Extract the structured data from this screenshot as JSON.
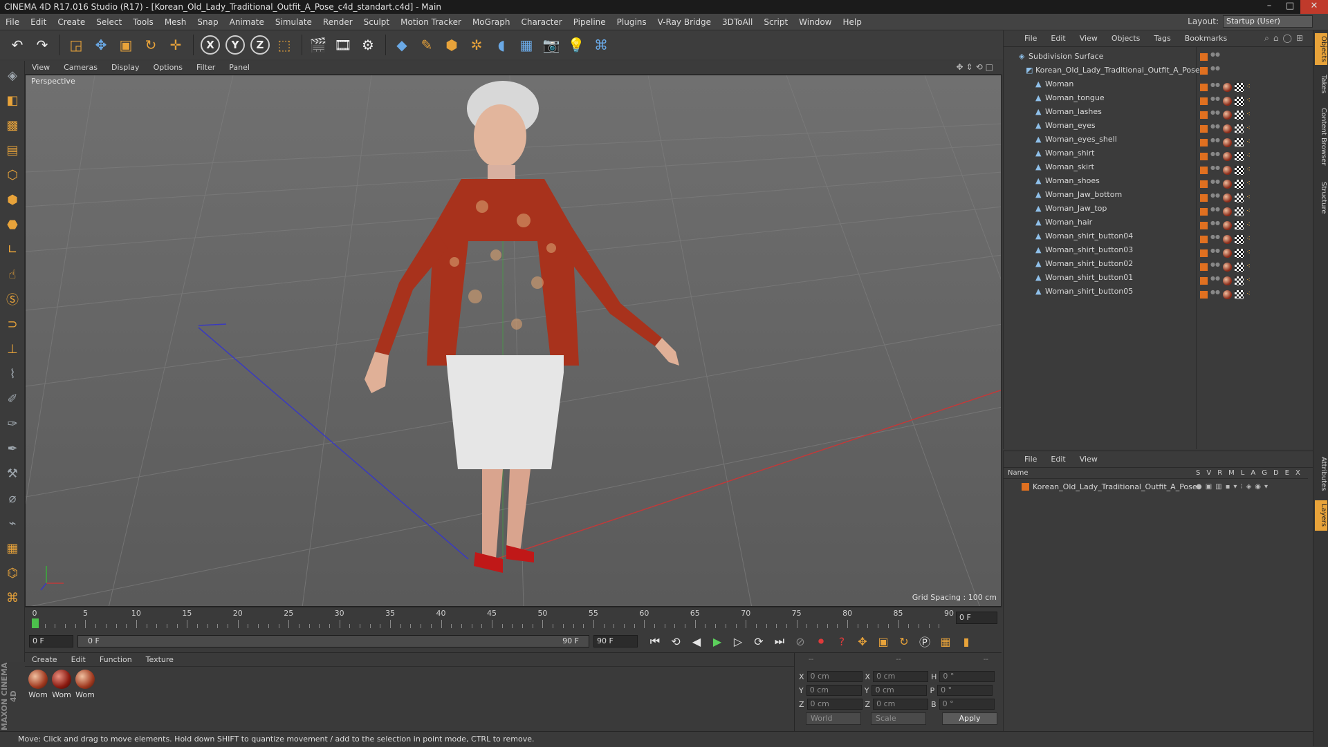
{
  "window": {
    "title": "CINEMA 4D R17.016 Studio (R17) - [Korean_Old_Lady_Traditional_Outfit_A_Pose_c4d_standart.c4d] - Main"
  },
  "menu": [
    "File",
    "Edit",
    "Create",
    "Select",
    "Tools",
    "Mesh",
    "Snap",
    "Animate",
    "Simulate",
    "Render",
    "Sculpt",
    "Motion Tracker",
    "MoGraph",
    "Character",
    "Pipeline",
    "Plugins",
    "V-Ray Bridge",
    "3DToAll",
    "Script",
    "Window",
    "Help"
  ],
  "layout": {
    "label": "Layout:",
    "value": "Startup (User)"
  },
  "toolbar": {
    "x_label": "X",
    "y_label": "Y",
    "z_label": "Z"
  },
  "viewport": {
    "menu": [
      "View",
      "Cameras",
      "Display",
      "Options",
      "Filter",
      "Panel"
    ],
    "label": "Perspective",
    "grid_spacing": "Grid Spacing : 100 cm"
  },
  "timeline": {
    "ticks": [
      "0",
      "5",
      "10",
      "15",
      "20",
      "25",
      "30",
      "35",
      "40",
      "45",
      "50",
      "55",
      "60",
      "65",
      "70",
      "75",
      "80",
      "85",
      "90"
    ],
    "current_frame": "0 F"
  },
  "transport": {
    "start": "0 F",
    "range_start": "0 F",
    "range_end": "90 F",
    "end": "90 F"
  },
  "material_manager": {
    "menu": [
      "Create",
      "Edit",
      "Function",
      "Texture"
    ],
    "materials": [
      "Wom",
      "Wom",
      "Wom"
    ]
  },
  "coordinates": {
    "header": [
      "--",
      "--",
      "--"
    ],
    "rows": [
      {
        "a": "X",
        "av": "0 cm",
        "b": "X",
        "bv": "0 cm",
        "c": "H",
        "cv": "0 °"
      },
      {
        "a": "Y",
        "av": "0 cm",
        "b": "Y",
        "bv": "0 cm",
        "c": "P",
        "cv": "0 °"
      },
      {
        "a": "Z",
        "av": "0 cm",
        "b": "Z",
        "bv": "0 cm",
        "c": "B",
        "cv": "0 °"
      }
    ],
    "world": "World",
    "scale": "Scale",
    "apply": "Apply"
  },
  "brand": "MAXON CINEMA 4D",
  "status": "Move: Click and drag to move elements. Hold down SHIFT to quantize movement / add to the selection in point mode, CTRL to remove.",
  "object_manager": {
    "menu": [
      "File",
      "Edit",
      "View",
      "Objects",
      "Tags",
      "Bookmarks"
    ],
    "root": "Subdivision Surface",
    "group": "Korean_Old_Lady_Traditional_Outfit_A_Pose",
    "objects": [
      "Woman",
      "Woman_tongue",
      "Woman_lashes",
      "Woman_eyes",
      "Woman_eyes_shell",
      "Woman_shirt",
      "Woman_skirt",
      "Woman_shoes",
      "Woman_Jaw_bottom",
      "Woman_Jaw_top",
      "Woman_hair",
      "Woman_shirt_button04",
      "Woman_shirt_button03",
      "Woman_shirt_button02",
      "Woman_shirt_button01",
      "Woman_shirt_button05"
    ]
  },
  "layer_manager": {
    "menu": [
      "File",
      "Edit",
      "View"
    ],
    "name_header": "Name",
    "col_headers": [
      "S",
      "V",
      "R",
      "M",
      "L",
      "A",
      "G",
      "D",
      "E",
      "X"
    ],
    "layer": "Korean_Old_Lady_Traditional_Outfit_A_Pose"
  },
  "side_tabs": [
    "Objects",
    "Takes",
    "Content Browser",
    "Structure",
    "Attributes",
    "Layers"
  ]
}
